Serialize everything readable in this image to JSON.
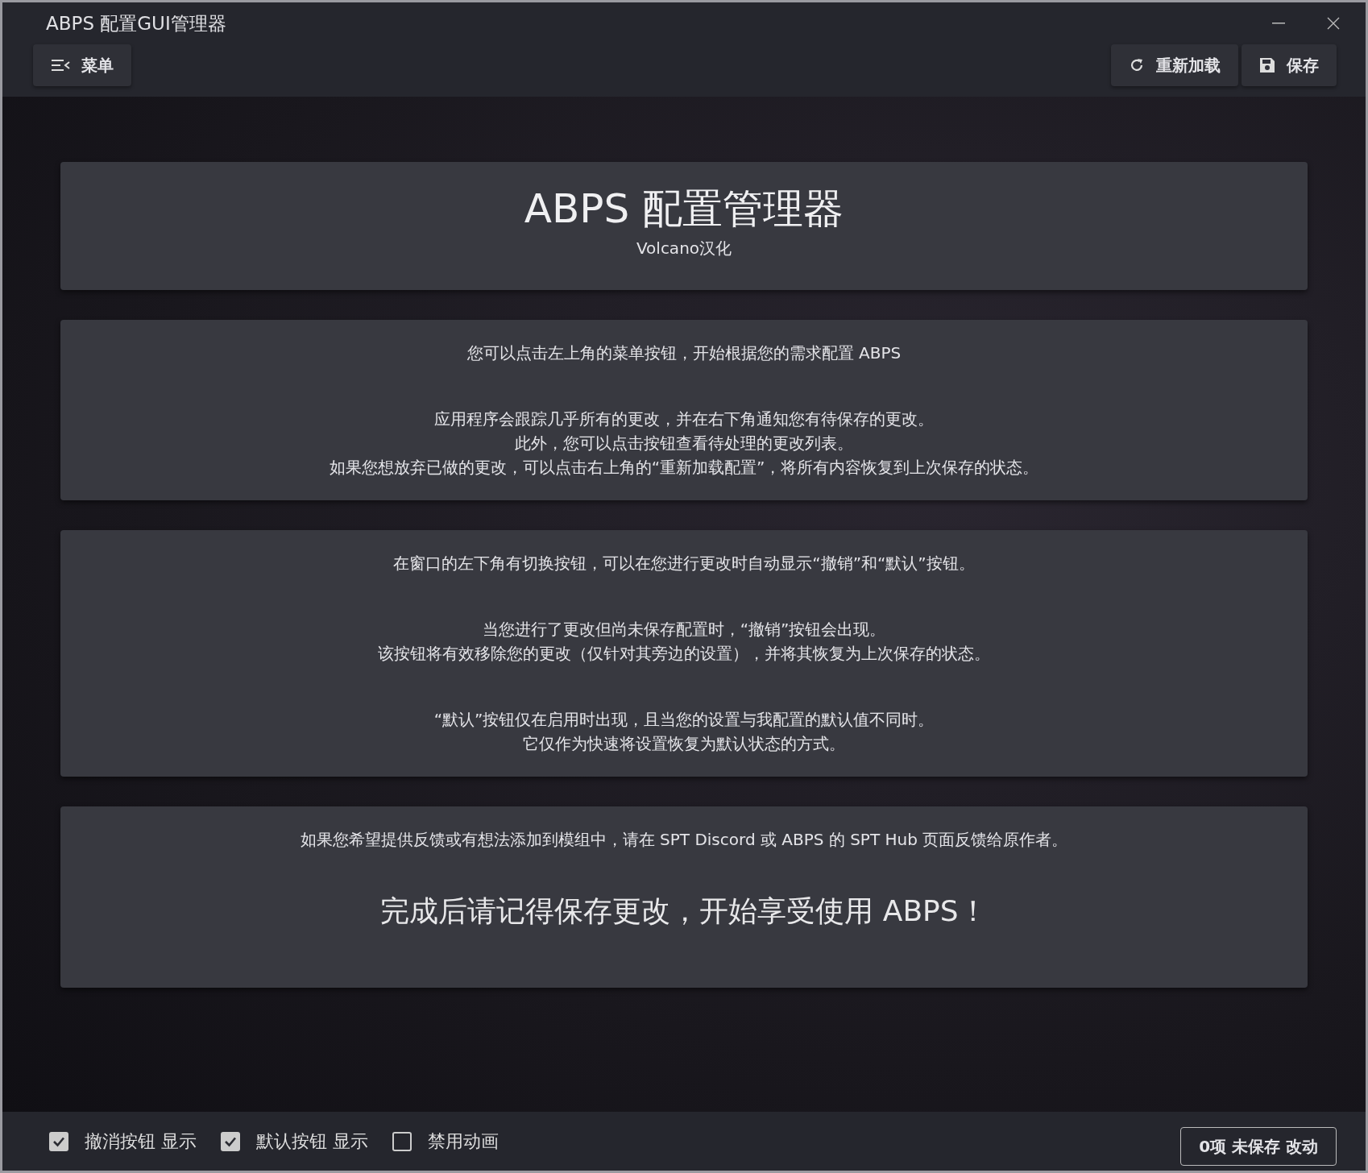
{
  "window": {
    "title": "ABPS 配置GUI管理器"
  },
  "toolbar": {
    "menu_button": {
      "label": "菜单"
    },
    "actions": [
      {
        "kind": "reload",
        "label": "重新加载"
      },
      {
        "kind": "save",
        "label": "保存"
      }
    ]
  },
  "cards": [
    {
      "kind": "header",
      "title": "ABPS 配置管理器",
      "subtitle": "Volcano汉化"
    },
    {
      "kind": "text",
      "paragraphs": [
        [
          "您可以点击左上角的菜单按钮，开始根据您的需求配置 ABPS"
        ],
        [
          "应用程序会跟踪几乎所有的更改，并在右下角通知您有待保存的更改。",
          "此外，您可以点击按钮查看待处理的更改列表。",
          "如果您想放弃已做的更改，可以点击右上角的“重新加载配置”，将所有内容恢复到上次保存的状态。"
        ]
      ]
    },
    {
      "kind": "text",
      "paragraphs": [
        [
          "在窗口的左下角有切换按钮，可以在您进行更改时自动显示“撤销”和“默认”按钮。"
        ],
        [
          "当您进行了更改但尚未保存配置时，“撤销”按钮会出现。",
          "该按钮将有效移除您的更改（仅针对其旁边的设置），并将其恢复为上次保存的状态。"
        ],
        [
          "“默认”按钮仅在启用时出现，且当您的设置与我配置的默认值不同时。",
          "它仅作为快速将设置恢复为默认状态的方式。"
        ]
      ]
    },
    {
      "kind": "closing",
      "paragraphs": [
        [
          "如果您希望提供反馈或有想法添加到模组中，请在 SPT Discord 或 ABPS 的 SPT Hub 页面反馈给原作者。"
        ]
      ],
      "emphasis": "完成后请记得保存更改，开始享受使用 ABPS！"
    }
  ],
  "footer": {
    "toggles": [
      {
        "label": "撤消按钮 显示",
        "checked": true
      },
      {
        "label": "默认按钮 显示",
        "checked": true
      },
      {
        "label": "禁用动画",
        "checked": false
      }
    ],
    "unsaved_button": {
      "label": "0项 未保存 改动"
    }
  }
}
